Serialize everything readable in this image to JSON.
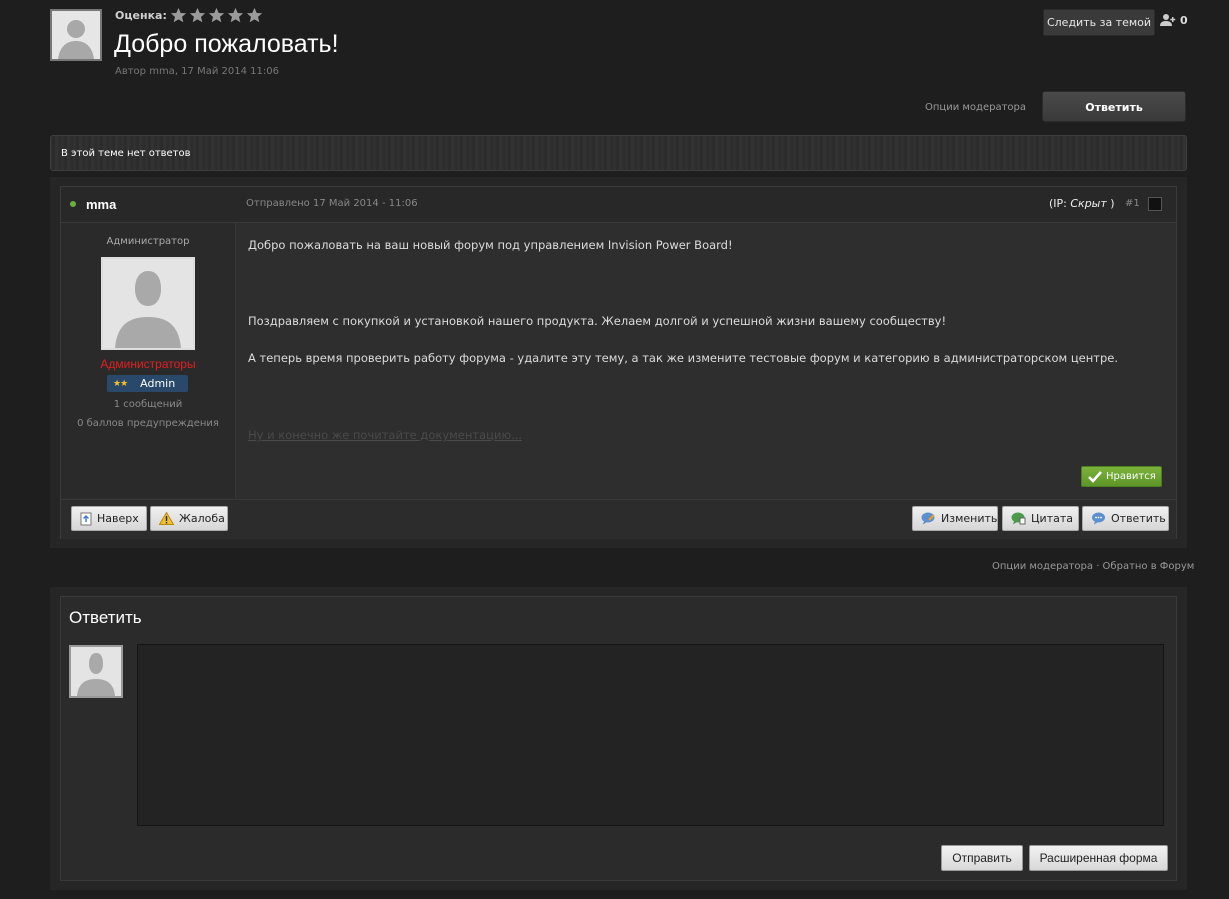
{
  "topic": {
    "rating_label": "Оценка:",
    "rating": 0,
    "rating_max": 5,
    "title": "Добро пожаловать!",
    "meta": "Автор mma, 17 Май 2014 11:06",
    "follow_label": "Следить за темой",
    "followers_count": "0"
  },
  "top_actions": {
    "mod_options": "Опции модератора",
    "reply_button": "Ответить"
  },
  "no_replies": "В этой теме нет ответов",
  "post": {
    "author": "mma",
    "date": "Отправлено 17 Май 2014 - 11:06",
    "ip_prefix": "(IP: ",
    "ip_value": "Скрыт",
    "ip_suffix": ")",
    "number": "#1",
    "author_role": "Администратор",
    "author_group": "Администраторы",
    "badge_stars": "★★",
    "badge_text": "Admin",
    "author_posts": "1 сообщений",
    "author_warnings": "0 баллов предупреждения",
    "paragraphs": [
      "Добро пожаловать на ваш новый форум под управлением Invision Power Board!",
      "Поздравляем с покупкой и установкой нашего продукта. Желаем долгой и успешной жизни вашему сообществу!",
      "А теперь время проверить работу форума - удалите эту тему, а так же измените тестовые форум и категорию в администраторском центре."
    ],
    "link_text": "Ну и конечно же почитайте документацию...",
    "like_button": "Нравится",
    "buttons": {
      "top": "Наверх",
      "report": "Жалоба",
      "edit": "Изменить",
      "quote": "Цитата",
      "reply": "Ответить"
    }
  },
  "footer_links": "Опции модератора · Обратно в Форум",
  "reply_form": {
    "title": "Ответить",
    "editor_value": "",
    "submit": "Отправить",
    "advanced": "Расширенная форма"
  },
  "colors": {
    "background": "#1e1e1e",
    "author_group": "#e02020",
    "like": "#6ea52f",
    "badge": "#29486a"
  }
}
